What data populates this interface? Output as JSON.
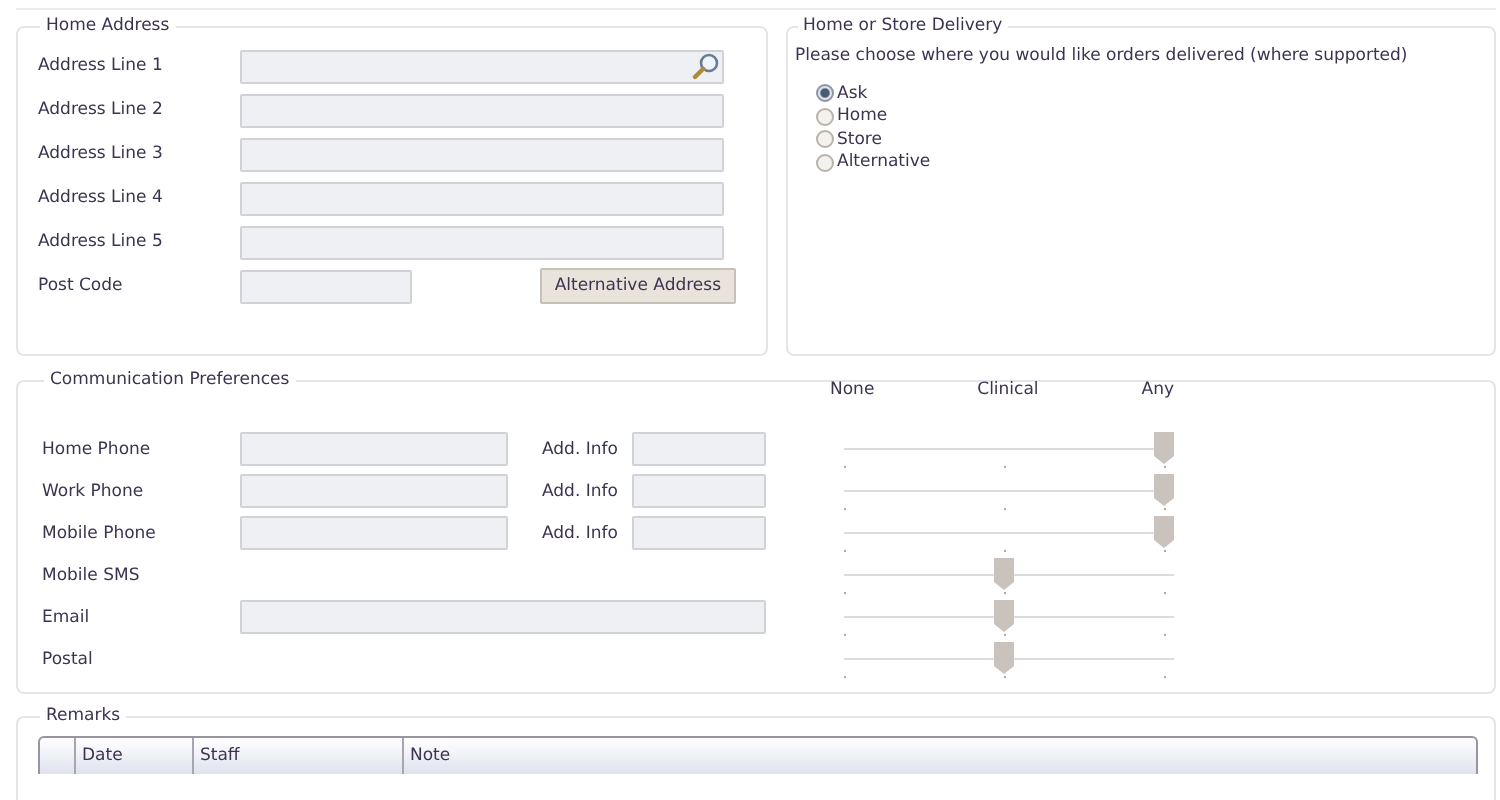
{
  "home_address": {
    "title": "Home Address",
    "fields": [
      {
        "label": "Address Line 1",
        "search": true
      },
      {
        "label": "Address Line 2",
        "search": false
      },
      {
        "label": "Address Line 3",
        "search": false
      },
      {
        "label": "Address Line 4",
        "search": false
      },
      {
        "label": "Address Line 5",
        "search": false
      }
    ],
    "post_code": {
      "label": "Post Code"
    },
    "button": "Alternative Address"
  },
  "delivery": {
    "title": "Home or Store Delivery",
    "prompt": "Please choose where you would like orders delivered (where supported)",
    "options": [
      {
        "label": "Ask",
        "selected": true
      },
      {
        "label": "Home",
        "selected": false
      },
      {
        "label": "Store",
        "selected": false
      },
      {
        "label": "Alternative",
        "selected": false
      }
    ]
  },
  "communication": {
    "title": "Communication Preferences",
    "scale": [
      "None",
      "Clinical",
      "Any"
    ],
    "rows": [
      {
        "label": "Home Phone",
        "kind": "phone",
        "extra_label": "Add. Info",
        "level": 1
      },
      {
        "label": "Work Phone",
        "kind": "phone",
        "extra_label": "Add. Info",
        "level": 1
      },
      {
        "label": "Mobile Phone",
        "kind": "phone",
        "extra_label": "Add. Info",
        "level": 1
      },
      {
        "label": "Mobile SMS",
        "kind": "plain",
        "level": 0.5
      },
      {
        "label": "Email",
        "kind": "wide",
        "level": 0.5
      },
      {
        "label": "Postal",
        "kind": "plain",
        "level": 0.5
      }
    ]
  },
  "remarks": {
    "title": "Remarks",
    "columns": [
      "Date",
      "Staff",
      "Note"
    ]
  }
}
